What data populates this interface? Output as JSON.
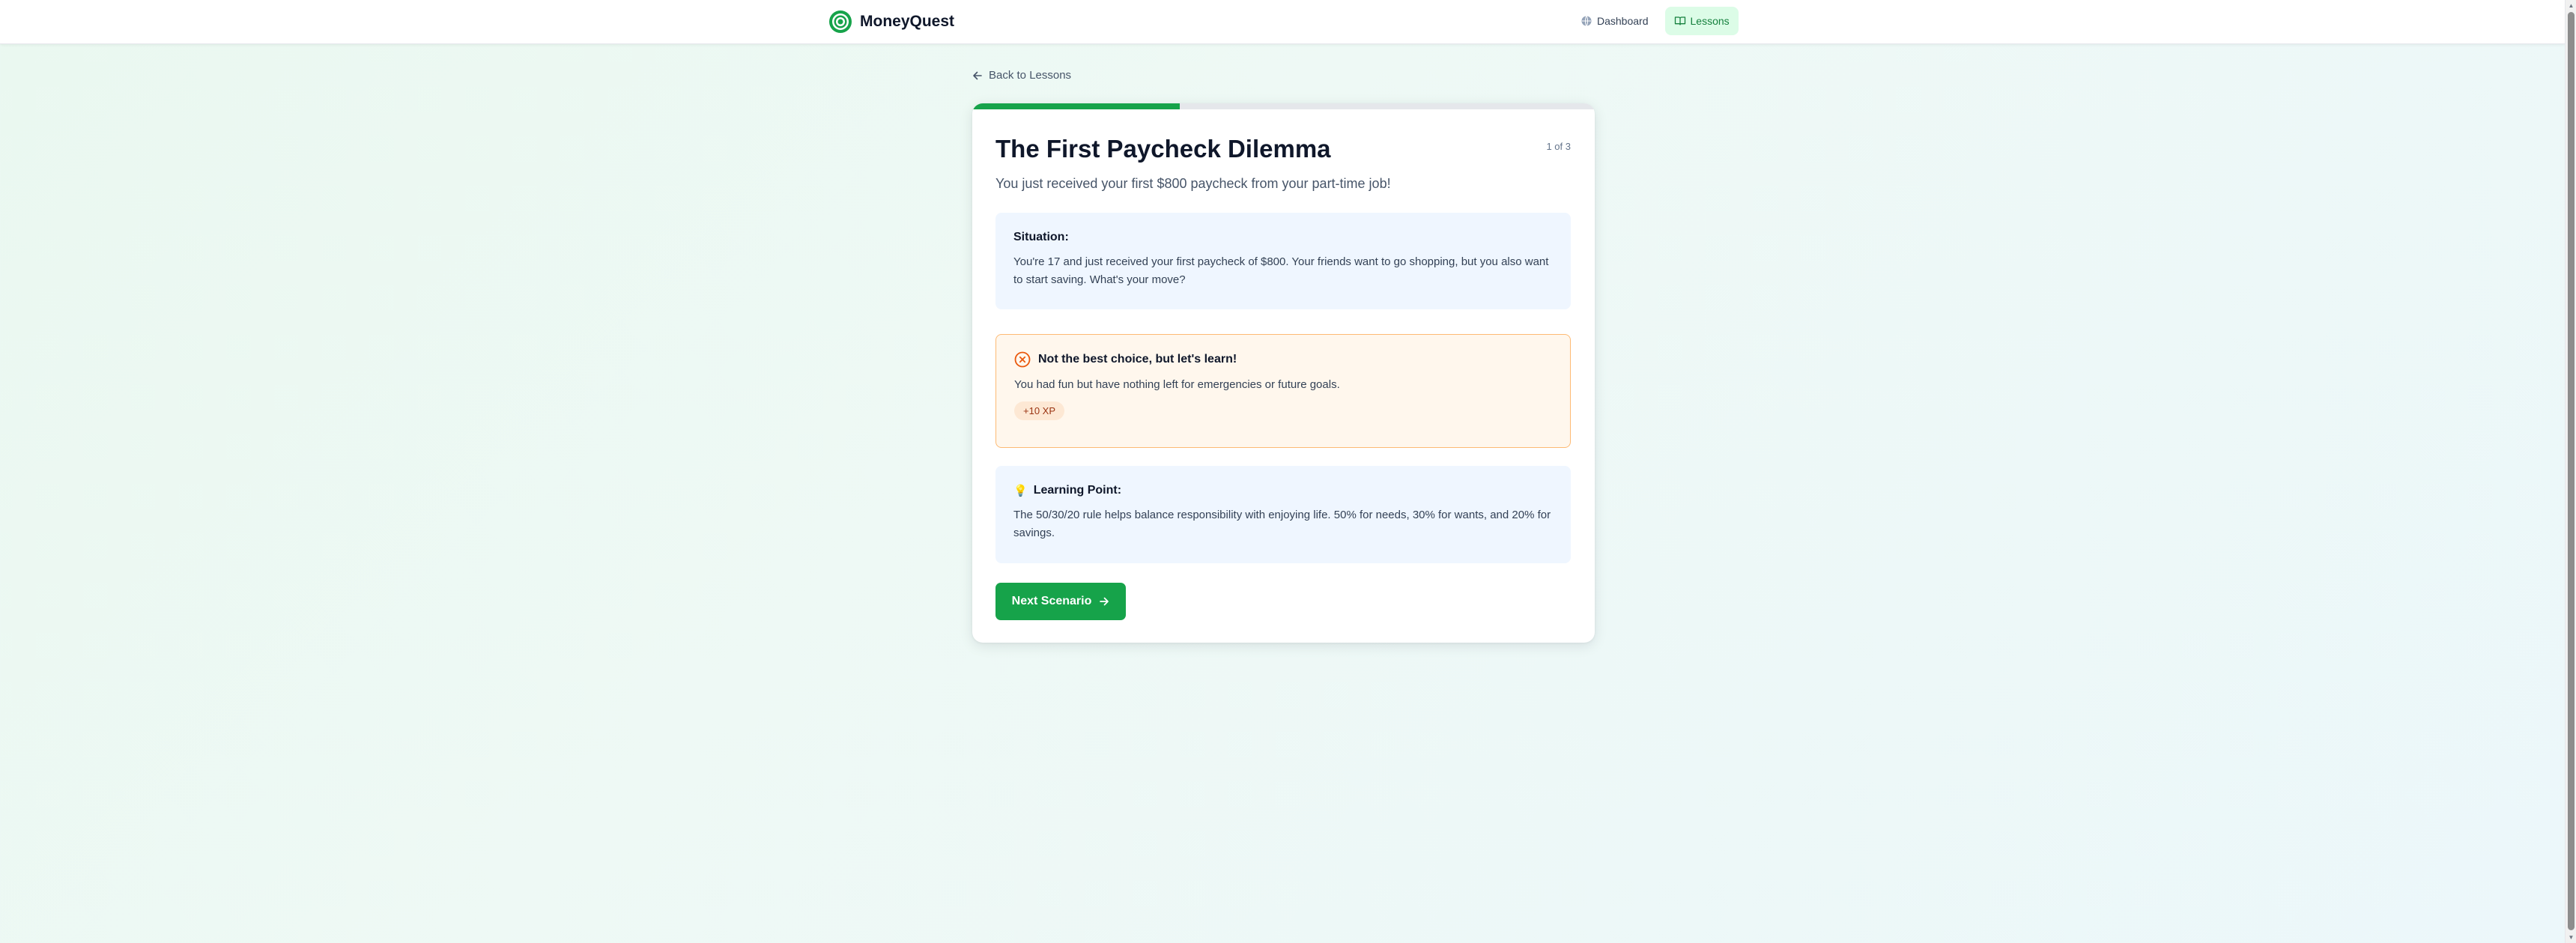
{
  "header": {
    "brand": "MoneyQuest",
    "nav": [
      {
        "label": "Dashboard",
        "icon": "globe-icon",
        "active": false
      },
      {
        "label": "Lessons",
        "icon": "book-icon",
        "active": true
      }
    ]
  },
  "back_link": "Back to Lessons",
  "scenario": {
    "progress_fraction": 0.333,
    "counter": "1 of 3",
    "title": "The First Paycheck Dilemma",
    "subtitle": "You just received your first $800 paycheck from your part-time job!",
    "situation_heading": "Situation:",
    "situation_text": "You're 17 and just received your first paycheck of $800. Your friends want to go shopping, but you also want to start saving. What's your move?"
  },
  "feedback": {
    "title": "Not the best choice, but let's learn!",
    "text": "You had fun but have nothing left for emergencies or future goals.",
    "xp": "+10 XP"
  },
  "learning": {
    "heading": "Learning Point:",
    "text": "The 50/30/20 rule helps balance responsibility with enjoying life. 50% for needs, 30% for wants, and 20% for savings."
  },
  "next_button": "Next Scenario",
  "colors": {
    "brand_green": "#16a34a",
    "feedback_border": "#fdba74",
    "feedback_bg": "#fff7ed",
    "info_bg": "#eff6ff",
    "error_icon": "#ea580c"
  }
}
